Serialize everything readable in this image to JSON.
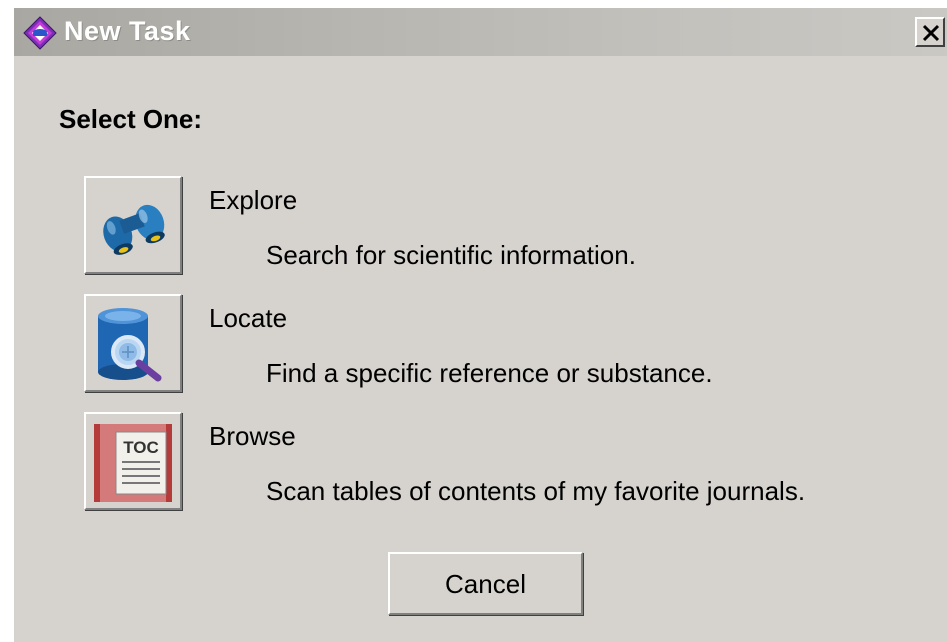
{
  "window": {
    "title": "New Task",
    "close_label": "X"
  },
  "prompt": "Select One:",
  "tasks": [
    {
      "name": "Explore",
      "description": "Search for scientific information.",
      "icon": "binoculars-icon"
    },
    {
      "name": "Locate",
      "description": "Find a specific reference or substance.",
      "icon": "database-search-icon"
    },
    {
      "name": "Browse",
      "description": "Scan tables of contents of my favorite journals.",
      "icon": "toc-book-icon",
      "icon_text": "TOC"
    }
  ],
  "cancel_label": "Cancel",
  "colors": {
    "dialog_bg": "#d6d3ce",
    "title_text": "#ffffff"
  }
}
